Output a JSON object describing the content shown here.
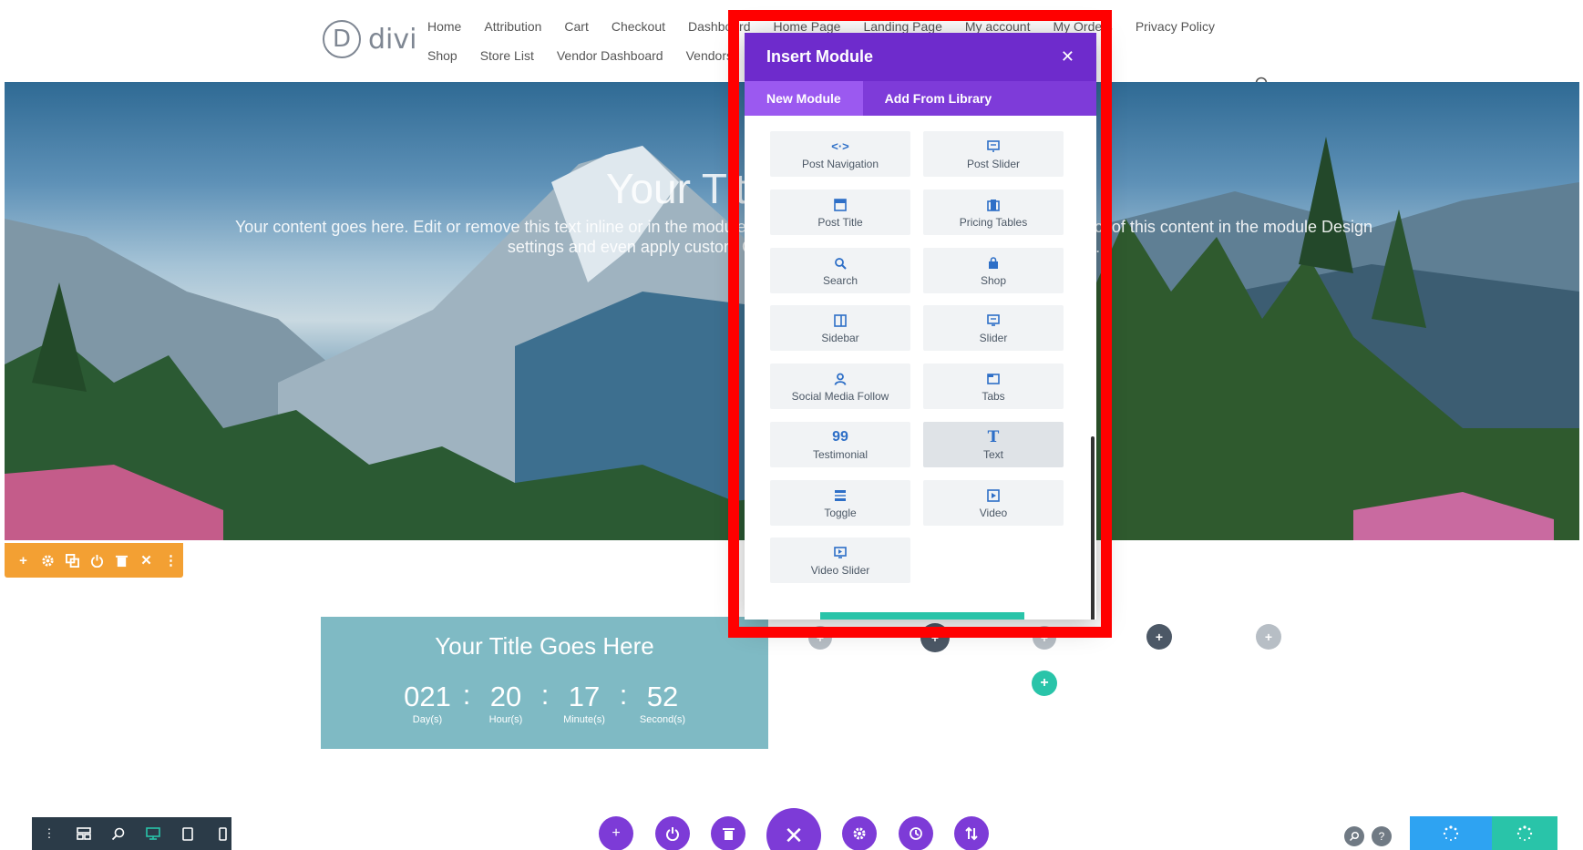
{
  "header": {
    "logo_letter": "D",
    "logo_text": "divi",
    "nav_row1": [
      "Home",
      "Attribution",
      "Cart",
      "Checkout",
      "Dashboard",
      "Home Page",
      "Landing Page",
      "My account",
      "My Orders",
      "Privacy Policy"
    ],
    "nav_row2": [
      "Shop",
      "Store List",
      "Vendor Dashboard",
      "Vendors"
    ]
  },
  "hero": {
    "title": "Your Title Goes Here",
    "text": "Your content goes here. Edit or remove this text inline or in the module Content settings. You can also style every aspect of this content in the module Design settings and even apply custom CSS to this text in the module Advanced settings."
  },
  "countdown": {
    "title": "Your Title Goes Here",
    "units": [
      {
        "value": "021",
        "label": "Day(s)"
      },
      {
        "value": "20",
        "label": "Hour(s)"
      },
      {
        "value": "17",
        "label": "Minute(s)"
      },
      {
        "value": "52",
        "label": "Second(s)"
      }
    ],
    "separator": ":"
  },
  "modal": {
    "title": "Insert Module",
    "close": "✕",
    "tabs": [
      {
        "label": "New Module",
        "active": true
      },
      {
        "label": "Add From Library",
        "active": false
      }
    ],
    "modules": [
      {
        "label": "Post Navigation",
        "icon": "code-arrows-icon"
      },
      {
        "label": "Post Slider",
        "icon": "post-slider-icon"
      },
      {
        "label": "Post Title",
        "icon": "post-title-icon"
      },
      {
        "label": "Pricing Tables",
        "icon": "pricing-tables-icon"
      },
      {
        "label": "Search",
        "icon": "search-icon"
      },
      {
        "label": "Shop",
        "icon": "shopping-bag-icon"
      },
      {
        "label": "Sidebar",
        "icon": "sidebar-icon"
      },
      {
        "label": "Slider",
        "icon": "slider-icon"
      },
      {
        "label": "Social Media Follow",
        "icon": "person-icon"
      },
      {
        "label": "Tabs",
        "icon": "tabs-icon"
      },
      {
        "label": "Testimonial",
        "icon": "quote-icon"
      },
      {
        "label": "Text",
        "icon": "text-icon"
      },
      {
        "label": "Toggle",
        "icon": "toggle-icon"
      },
      {
        "label": "Video",
        "icon": "video-icon"
      },
      {
        "label": "Video Slider",
        "icon": "video-slider-icon"
      }
    ],
    "hovered_module": "Text"
  },
  "colors": {
    "purple": "#6e2bcc",
    "purple_tab": "#7e3bd9",
    "orange": "#f3a033",
    "teal": "#7fbac4",
    "highlight": "#ff0000",
    "blue": "#2ea3f2",
    "green": "#29c4a9"
  }
}
